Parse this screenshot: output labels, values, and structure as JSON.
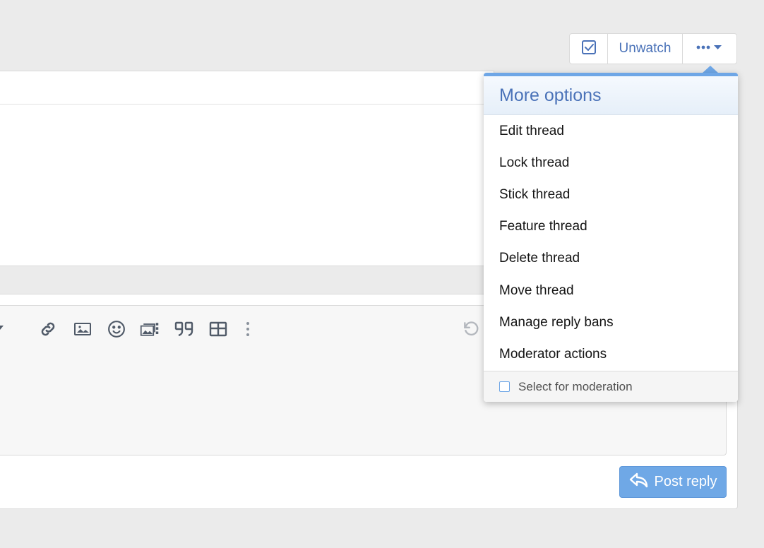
{
  "thread_actions": {
    "check_icon": "check-square-icon",
    "unwatch_label": "Unwatch",
    "more_icon": "ellipsis-caret-icon"
  },
  "editor": {
    "toolbar_icons": [
      "link-icon",
      "image-icon",
      "smiley-icon",
      "media-icon",
      "quote-icon",
      "table-icon",
      "vertical-dots-icon",
      "undo-icon"
    ]
  },
  "reply": {
    "post_label": "Post reply",
    "post_icon": "reply-icon"
  },
  "menu": {
    "title": "More options",
    "items": [
      {
        "label": "Edit thread"
      },
      {
        "label": "Lock thread"
      },
      {
        "label": "Stick thread"
      },
      {
        "label": "Feature thread"
      },
      {
        "label": "Delete thread"
      },
      {
        "label": "Move thread"
      },
      {
        "label": "Manage reply bans"
      },
      {
        "label": "Moderator actions"
      }
    ],
    "footer_label": "Select for moderation"
  },
  "colors": {
    "accent": "#47a7eb",
    "link": "#4a72b8",
    "post_button": "#6fa8e6"
  }
}
